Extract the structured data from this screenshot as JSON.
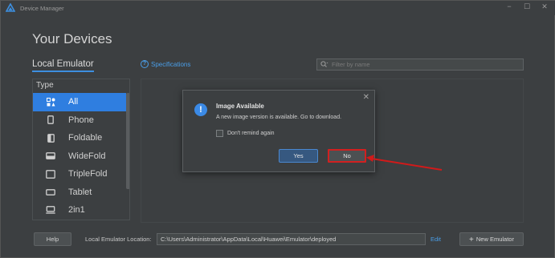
{
  "window": {
    "title": "Device Manager",
    "minimize": "−",
    "maximize": "☐",
    "close": "✕"
  },
  "page_title": "Your Devices",
  "tabs": {
    "local": "Local Emulator"
  },
  "specifications_link": "Specifications",
  "filter": {
    "placeholder": "Filter by name",
    "value": ""
  },
  "type_panel": {
    "header": "Type",
    "items": [
      {
        "label": "All",
        "icon": "grid-icon",
        "selected": true
      },
      {
        "label": "Phone",
        "icon": "phone-icon",
        "selected": false
      },
      {
        "label": "Foldable",
        "icon": "foldable-icon",
        "selected": false
      },
      {
        "label": "WideFold",
        "icon": "widefold-icon",
        "selected": false
      },
      {
        "label": "TripleFold",
        "icon": "triplefold-icon",
        "selected": false
      },
      {
        "label": "Tablet",
        "icon": "tablet-icon",
        "selected": false
      },
      {
        "label": "2in1",
        "icon": "laptop-icon",
        "selected": false
      }
    ]
  },
  "dialog": {
    "title": "Image Available",
    "message": "A new image version is available. Go to download.",
    "checkbox_label": "Don't remind again",
    "checkbox_checked": false,
    "yes_label": "Yes",
    "no_label": "No",
    "close": "✕"
  },
  "bottom": {
    "help_label": "Help",
    "location_label": "Local Emulator Location:",
    "location_value": "C:\\Users\\Administrator\\AppData\\Local\\Huawei\\Emulator\\deployed",
    "edit_label": "Edit",
    "new_emulator_label": "New Emulator",
    "new_emulator_plus": "+"
  },
  "colors": {
    "background": "#3c3f41",
    "accent": "#2f7ee0",
    "link": "#4a9ee8",
    "highlight_red": "#d12020"
  }
}
